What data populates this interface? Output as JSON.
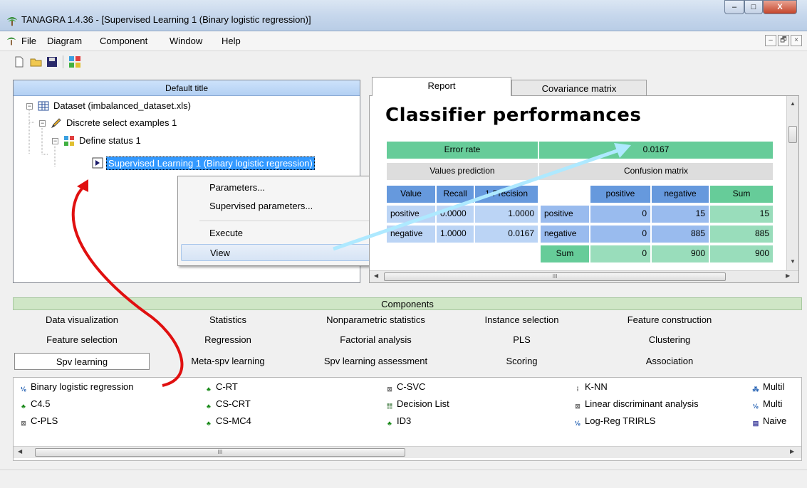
{
  "window": {
    "title": "TANAGRA 1.4.36 - [Supervised Learning 1 (Binary logistic regression)]",
    "min_glyph": "–",
    "max_glyph": "□",
    "close_glyph": "X"
  },
  "menu": {
    "items": [
      "File",
      "Diagram",
      "Component",
      "Window",
      "Help"
    ],
    "mdi": [
      "–",
      "🗗",
      "×"
    ]
  },
  "tree": {
    "header": "Default title",
    "nodes": [
      "Dataset (imbalanced_dataset.xls)",
      "Discrete select examples 1",
      "Define status 1",
      "Supervised Learning 1 (Binary logistic regression)"
    ]
  },
  "context_menu": {
    "items": [
      "Parameters...",
      "Supervised parameters...",
      "Execute",
      "View"
    ]
  },
  "tabs": [
    "Report",
    "Covariance matrix"
  ],
  "report": {
    "title": "Classifier performances",
    "error_rate_label": "Error rate",
    "error_rate_value": "0.0167",
    "values_prediction": "Values prediction",
    "confusion_matrix": "Confusion matrix",
    "vp_headers": [
      "Value",
      "Recall",
      "1-Precision"
    ],
    "vp_rows": [
      [
        "positive",
        "0.0000",
        "1.0000"
      ],
      [
        "negative",
        "1.0000",
        "0.0167"
      ]
    ],
    "cm_headers": [
      "positive",
      "negative",
      "Sum"
    ],
    "cm_rows": [
      [
        "positive",
        "0",
        "15",
        "15"
      ],
      [
        "negative",
        "0",
        "885",
        "885"
      ],
      [
        "Sum",
        "0",
        "900",
        "900"
      ]
    ],
    "hscroll_grip": "III"
  },
  "components": {
    "header": "Components",
    "tabs": [
      [
        "Data visualization",
        "Statistics",
        "Nonparametric statistics",
        "Instance selection",
        "Feature construction"
      ],
      [
        "Feature selection",
        "Regression",
        "Factorial analysis",
        "PLS",
        "Clustering"
      ],
      [
        "Spv learning",
        "Meta-spv learning",
        "Spv learning assessment",
        "Scoring",
        "Association"
      ]
    ],
    "items": [
      [
        "Binary logistic regression",
        "C-RT",
        "C-SVC",
        "K-NN",
        "Multil"
      ],
      [
        "C4.5",
        "CS-CRT",
        "Decision List",
        "Linear discriminant analysis",
        "Multi"
      ],
      [
        "C-PLS",
        "CS-MC4",
        "ID3",
        "Log-Reg TRIRLS",
        "Naive"
      ]
    ],
    "hscroll_grip": "III"
  },
  "colors": {
    "selection": "#3399ff",
    "annotation_red": "#e01010",
    "annotation_cyan": "#aee9ff",
    "green_dark": "#66cc99",
    "blue_dark": "#6699dd"
  }
}
